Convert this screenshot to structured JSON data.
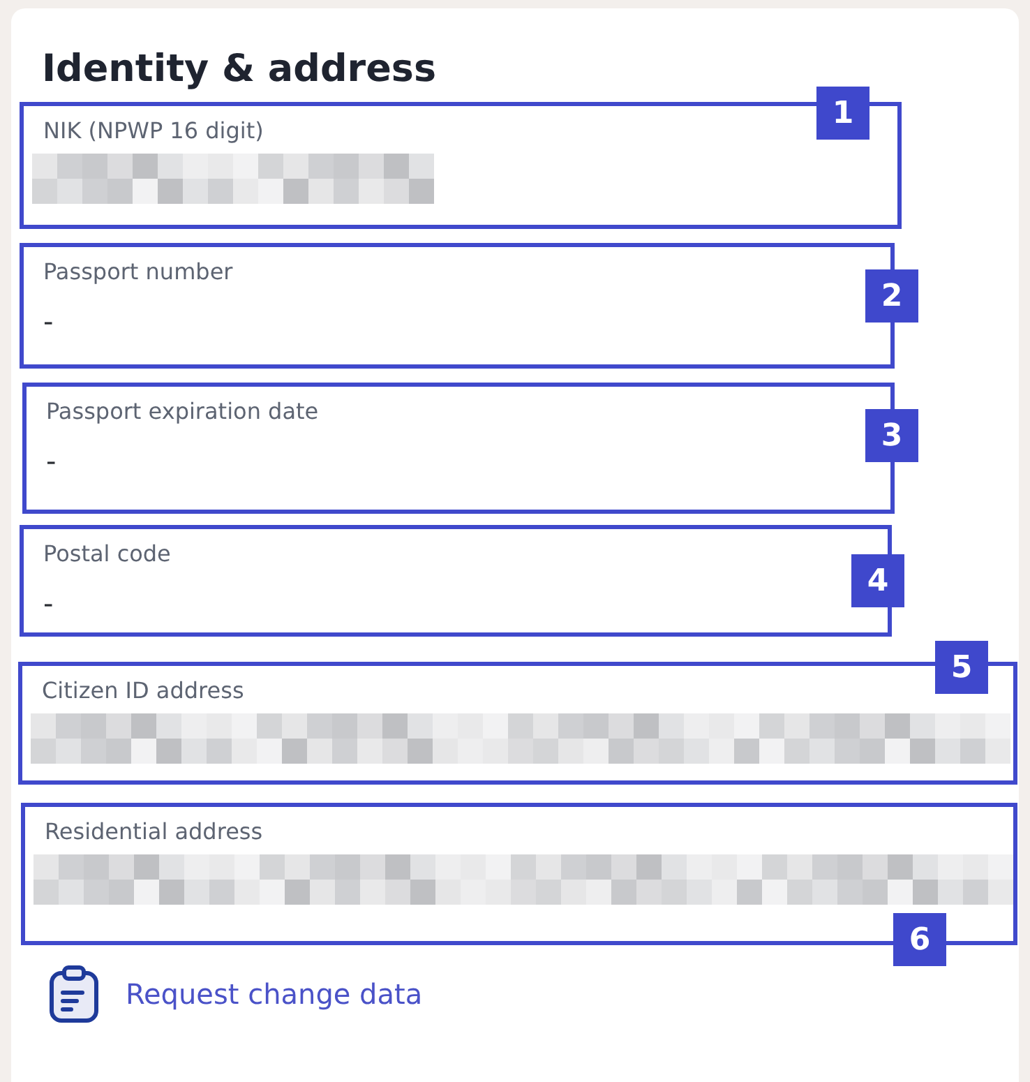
{
  "card": {
    "title": "Identity & address",
    "fields": [
      {
        "badge": "1",
        "label": "NIK (NPWP 16 digit)",
        "kind": "mask"
      },
      {
        "badge": "2",
        "label": "Passport number",
        "kind": "text",
        "value": "-"
      },
      {
        "badge": "3",
        "label": "Passport expiration date",
        "kind": "text",
        "value": "-"
      },
      {
        "badge": "4",
        "label": "Postal code",
        "kind": "text",
        "value": "-"
      },
      {
        "badge": "5",
        "label": "Citizen ID address",
        "kind": "longmask"
      },
      {
        "badge": "6",
        "label": "Residential address",
        "kind": "longmask"
      }
    ],
    "link": {
      "label": "Request change data"
    }
  }
}
